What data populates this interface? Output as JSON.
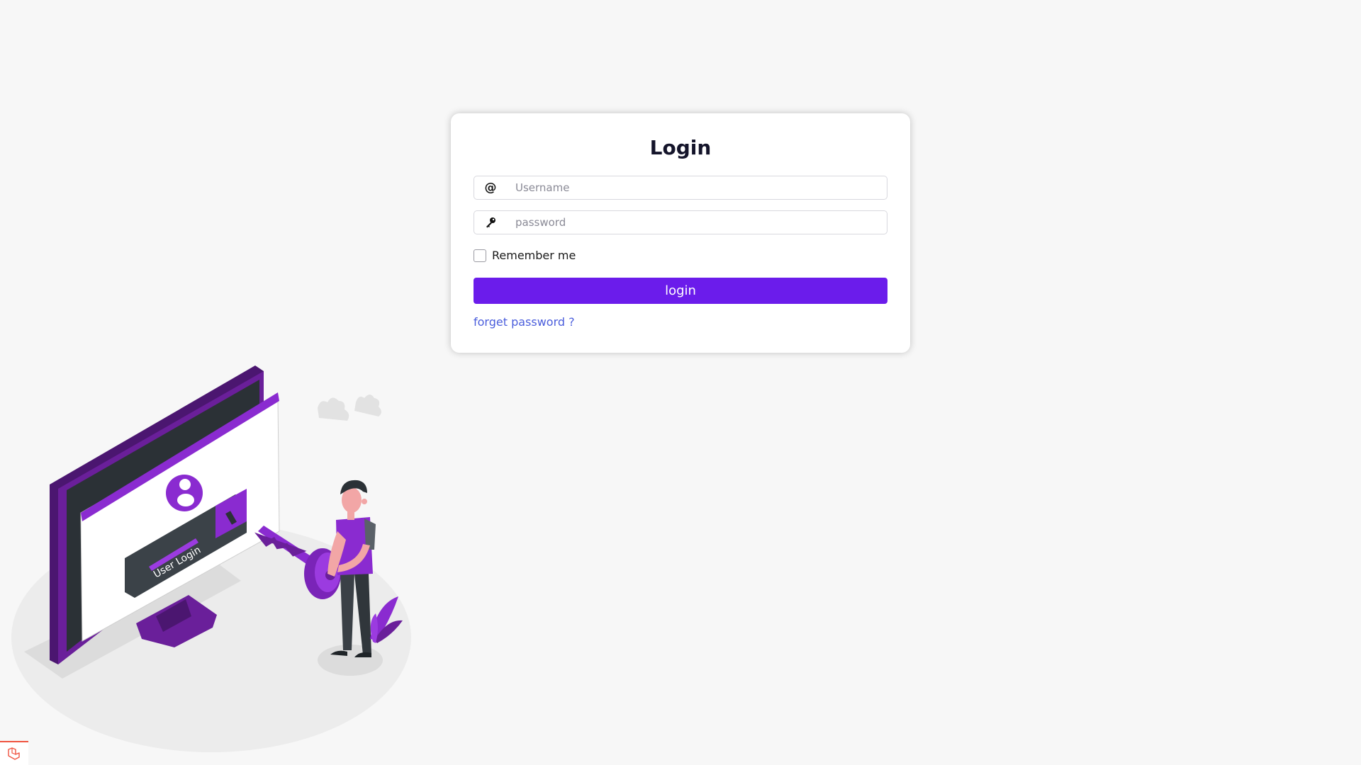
{
  "login_form": {
    "title": "Login",
    "username": {
      "icon": "at-icon",
      "icon_glyph": "@",
      "placeholder": "Username",
      "value": ""
    },
    "password": {
      "icon": "key-icon",
      "placeholder": "password",
      "value": ""
    },
    "remember_label": "Remember me",
    "remember_checked": false,
    "submit_label": "login",
    "forgot_link": "forget password ?"
  },
  "illustration": {
    "label": "User Login"
  },
  "colors": {
    "background": "#f7f7f7",
    "primary": "#6b1ceb",
    "link": "#4a5ddc",
    "illustration_purple": "#7b22b8",
    "debug_badge": "#f05340"
  }
}
